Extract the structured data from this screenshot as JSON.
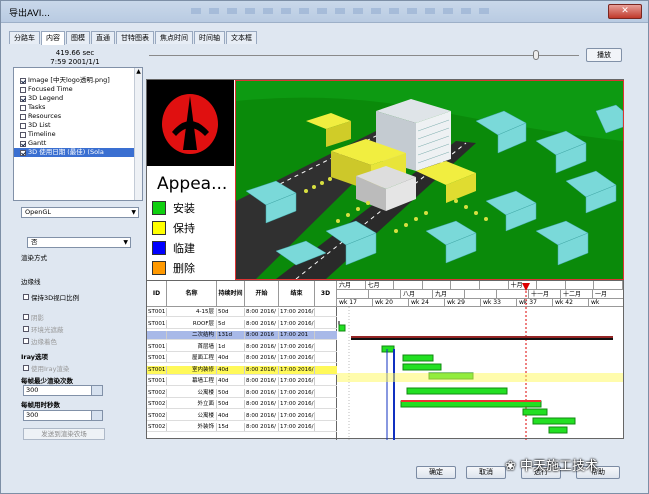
{
  "window": {
    "title": "导出AVI..."
  },
  "tabs": [
    "分路车",
    "内容",
    "图模",
    "直通",
    "甘特图表",
    "焦点时间",
    "时间轴",
    "文本框"
  ],
  "time": {
    "line1": "419.66 sec",
    "line2": "7:59 2001/1/1"
  },
  "play_label": "播放",
  "layers": [
    {
      "label": "Image [中天logo透明.png]",
      "checked": true
    },
    {
      "label": "Focused Time",
      "checked": false
    },
    {
      "label": "3D Legend",
      "checked": true
    },
    {
      "label": "Tasks",
      "checked": false
    },
    {
      "label": "Resources",
      "checked": false
    },
    {
      "label": "3D List",
      "checked": false
    },
    {
      "label": "Timeline",
      "checked": false
    },
    {
      "label": "Gantt",
      "checked": true
    },
    {
      "label": "3D 使用日期 (最佳) (Sola",
      "checked": true,
      "selected": true
    }
  ],
  "renderer": {
    "value": "OpenGL"
  },
  "render_mode": {
    "value": "否"
  },
  "labels": {
    "render_hint": "渲染方式",
    "section_lines": "边缘线",
    "keep_aspect": "保持3D视口比例",
    "shadow": "阴影",
    "ambient": "环境光遮蔽",
    "edge_color": "边缘着色",
    "iray_title": "Iray选项",
    "iray_use": "使用Iray渲染",
    "per_frame_label": "每帧最少渲染次数",
    "per_frame_value": "300",
    "per_frame_sec_label": "每帧用时秒数",
    "per_frame_sec_value": "300",
    "send_button": "发送到渲染农场"
  },
  "legend": {
    "title": "Appea...",
    "items": [
      {
        "label": "安装",
        "color": "#10d010"
      },
      {
        "label": "保持",
        "color": "#ffff00"
      },
      {
        "label": "临建",
        "color": "#0000ff"
      },
      {
        "label": "删除",
        "color": "#ff9900"
      }
    ]
  },
  "gantt": {
    "headers": [
      "ID",
      "名称",
      "持续时间",
      "开始",
      "结束",
      "3D"
    ],
    "rows": [
      {
        "id": "ST001",
        "name": "4-15层",
        "dur": "50d",
        "start": "8:00 2016/",
        "end": "17:00 2016/",
        "style": ""
      },
      {
        "id": "ST001",
        "name": "ROOF层",
        "dur": "5d",
        "start": "8:00 2016/",
        "end": "17:00 2016/",
        "style": ""
      },
      {
        "id": "",
        "name": "二次结构",
        "dur": "131d",
        "start": "8:00 2016",
        "end": "17:00 201",
        "style": "sum"
      },
      {
        "id": "ST001",
        "name": "首层墙",
        "dur": "1d",
        "start": "8:00 2016/",
        "end": "17:00 2016/",
        "style": ""
      },
      {
        "id": "ST001",
        "name": "屋面工程",
        "dur": "40d",
        "start": "8:00 2016/",
        "end": "17:00 2016/",
        "style": ""
      },
      {
        "id": "ST001",
        "name": "室内装修",
        "dur": "40d",
        "start": "8:00 2016/",
        "end": "17:00 2016/",
        "style": "hl"
      },
      {
        "id": "ST001",
        "name": "幕墙工程",
        "dur": "40d",
        "start": "8:00 2016/",
        "end": "17:00 2016/",
        "style": ""
      },
      {
        "id": "ST002",
        "name": "公寓楼",
        "dur": "50d",
        "start": "8:00 2016/",
        "end": "17:00 2016/",
        "style": ""
      },
      {
        "id": "ST002",
        "name": "外立面",
        "dur": "50d",
        "start": "8:00 2016/",
        "end": "17:00 2016/",
        "style": ""
      },
      {
        "id": "ST002",
        "name": "公寓楼",
        "dur": "40d",
        "start": "8:00 2016/",
        "end": "17:00 2016/",
        "style": ""
      },
      {
        "id": "ST002",
        "name": "外装饰",
        "dur": "15d",
        "start": "8:00 2016/",
        "end": "17:00 2016/",
        "style": ""
      }
    ],
    "timeline_top": [
      "六月",
      "七月",
      "",
      "",
      "",
      "",
      "十月",
      "",
      "",
      ""
    ],
    "timeline_mid": [
      "",
      "",
      "八月",
      "九月",
      "",
      "",
      "十一月",
      "十二月",
      "一月"
    ],
    "timeline_weeks": [
      "wk 17",
      "wk 20",
      "wk 24",
      "wk 29",
      "wk 33",
      "wk 37",
      "wk 42",
      "wk"
    ]
  },
  "buttons": {
    "ok": "确定",
    "cancel": "取消",
    "apply": "选行",
    "help": "帮助"
  },
  "watermark": "中天施工技术"
}
